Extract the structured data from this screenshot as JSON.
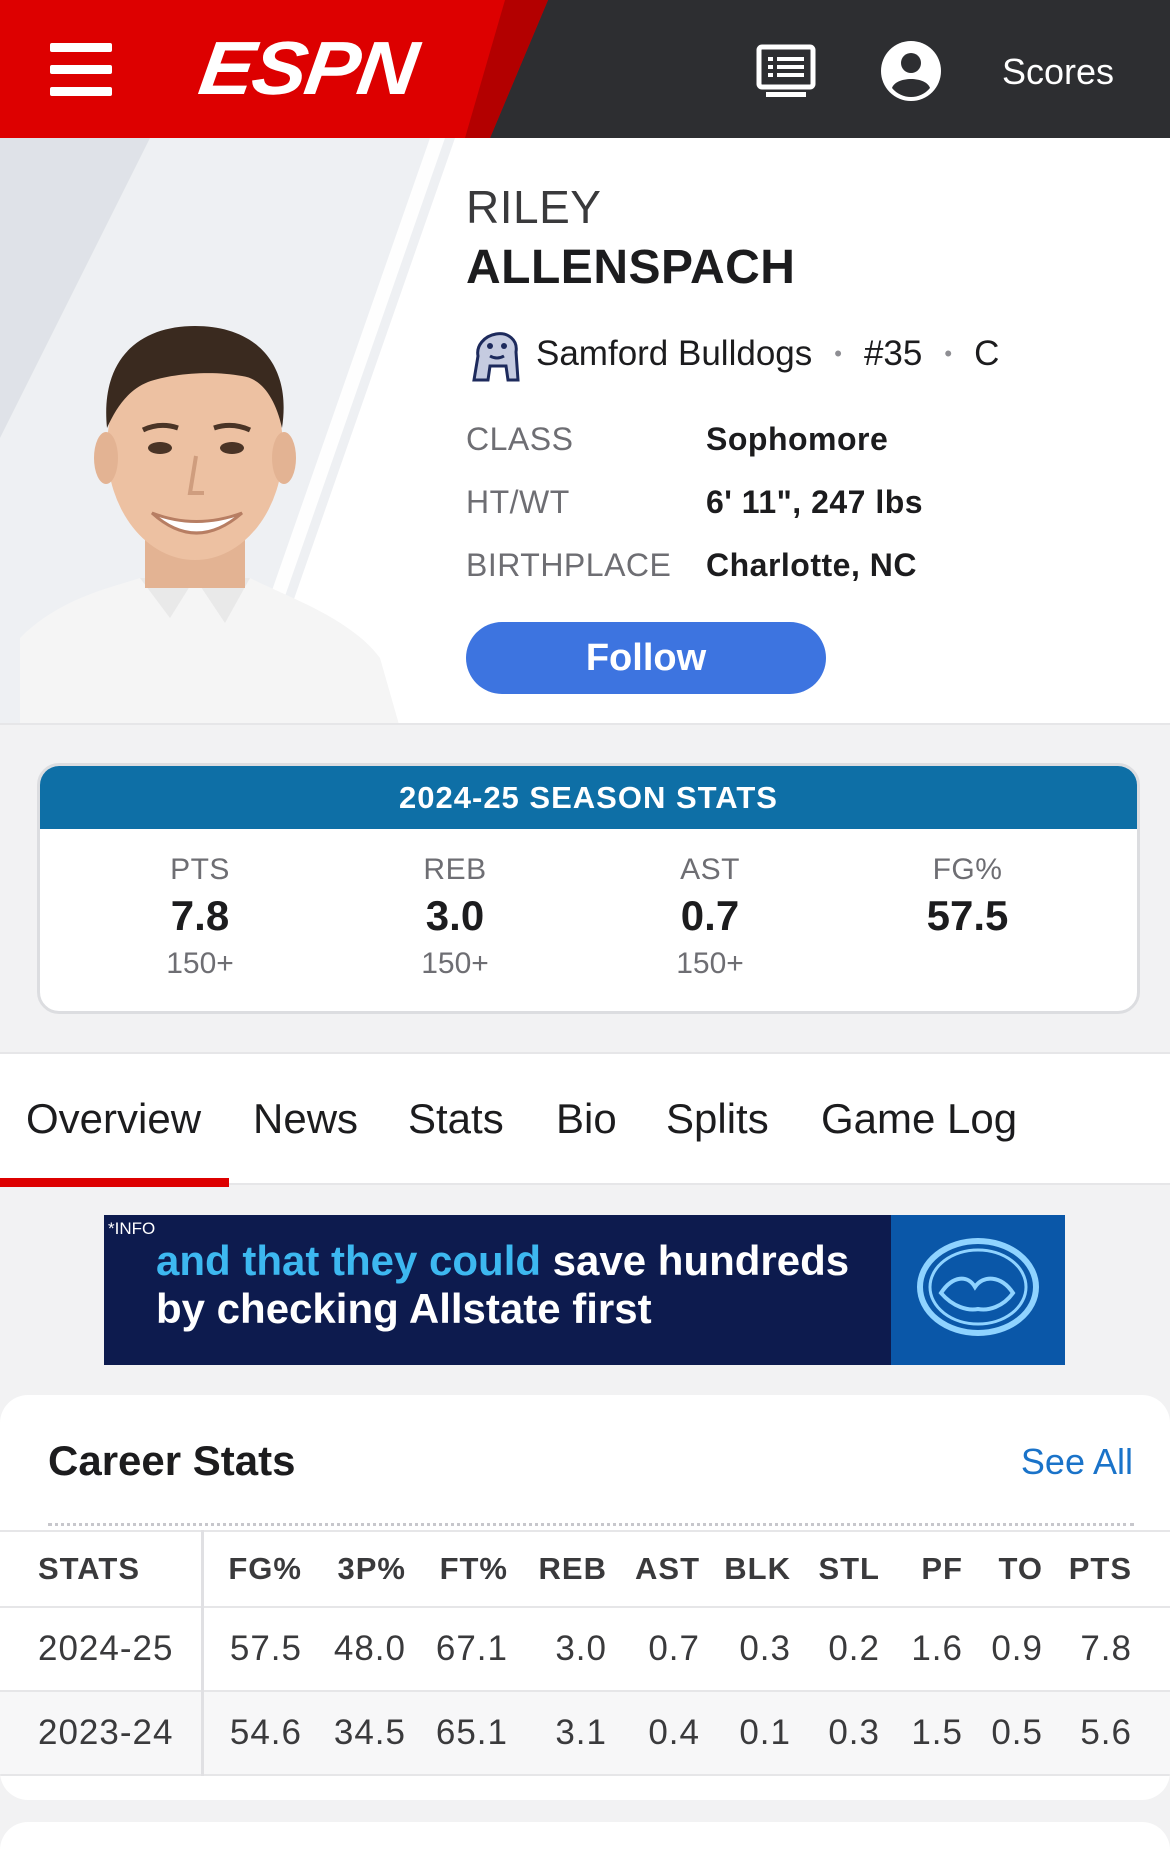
{
  "header": {
    "logo": "ESPN",
    "scores_label": "Scores",
    "icons": [
      "menu-icon",
      "news-feed-icon",
      "user-account-icon"
    ],
    "brand_red": "#dd0000"
  },
  "player": {
    "first_name": "RILEY",
    "last_name": "ALLENSPACH",
    "team": "Samford Bulldogs",
    "number": "#35",
    "position": "C",
    "bio": [
      {
        "label": "CLASS",
        "value": "Sophomore"
      },
      {
        "label": "HT/WT",
        "value": "6' 11\", 247 lbs"
      },
      {
        "label": "BIRTHPLACE",
        "value": "Charlotte, NC"
      }
    ],
    "follow_label": "Follow"
  },
  "season_stats": {
    "title": "2024-25 SEASON STATS",
    "stats": [
      {
        "label": "PTS",
        "value": "7.8",
        "rank": "150+"
      },
      {
        "label": "REB",
        "value": "3.0",
        "rank": "150+"
      },
      {
        "label": "AST",
        "value": "0.7",
        "rank": "150+"
      },
      {
        "label": "FG%",
        "value": "57.5",
        "rank": ""
      }
    ],
    "header_color": "#0e6fa6"
  },
  "tabs": [
    {
      "label": "Overview",
      "active": true
    },
    {
      "label": "News"
    },
    {
      "label": "Stats"
    },
    {
      "label": "Bio"
    },
    {
      "label": "Splits"
    },
    {
      "label": "Game Log"
    }
  ],
  "ad": {
    "info": "*INFO",
    "line1_highlight": "and that they could",
    "line1_rest": " save hundreds",
    "line2": "by checking Allstate first"
  },
  "career_stats": {
    "title": "Career Stats",
    "see_all": "See All",
    "columns": [
      "STATS",
      "FG%",
      "3P%",
      "FT%",
      "REB",
      "AST",
      "BLK",
      "STL",
      "PF",
      "TO",
      "PTS"
    ],
    "rows": [
      [
        "2024-25",
        "57.5",
        "48.0",
        "67.1",
        "3.0",
        "0.7",
        "0.3",
        "0.2",
        "1.6",
        "0.9",
        "7.8"
      ],
      [
        "2023-24",
        "54.6",
        "34.5",
        "65.1",
        "3.1",
        "0.4",
        "0.1",
        "0.3",
        "1.5",
        "0.5",
        "5.6"
      ]
    ]
  }
}
